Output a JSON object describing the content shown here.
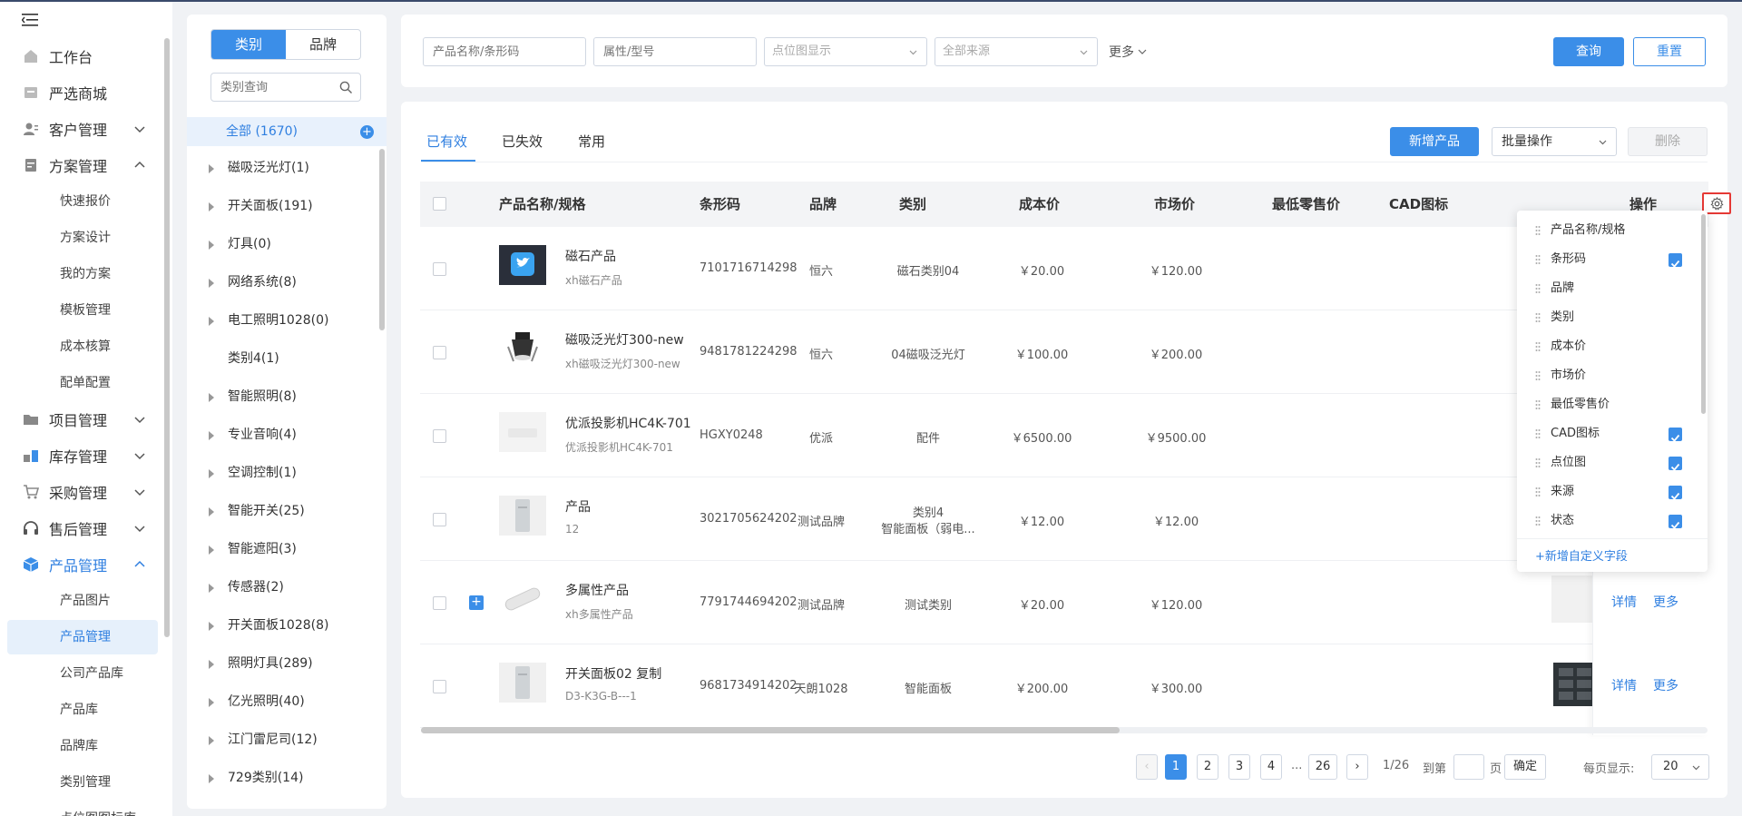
{
  "nav": {
    "top_items": [
      {
        "label": "工作台",
        "icon": "home-icon"
      },
      {
        "label": "严选商城",
        "icon": "shop-icon"
      },
      {
        "label": "客户管理",
        "icon": "user-icon"
      },
      {
        "label": "方案管理",
        "icon": "plan-icon"
      }
    ],
    "plan_subs": [
      "快速报价",
      "方案设计",
      "我的方案",
      "模板管理",
      "成本核算",
      "配单配置"
    ],
    "mid_items": [
      {
        "label": "项目管理",
        "icon": "folder-icon"
      },
      {
        "label": "库存管理",
        "icon": "stock-icon"
      },
      {
        "label": "采购管理",
        "icon": "cart-icon"
      },
      {
        "label": "售后管理",
        "icon": "headset-icon"
      },
      {
        "label": "产品管理",
        "icon": "box-icon"
      }
    ],
    "product_subs": [
      "产品图片",
      "产品管理",
      "公司产品库",
      "产品库",
      "品牌库",
      "类别管理",
      "点位图图标库"
    ]
  },
  "category_panel": {
    "tabs": [
      "类别",
      "品牌"
    ],
    "search_placeholder": "类别查询",
    "all_label": "全部 (1670)",
    "items": [
      "磁吸泛光灯(1)",
      "开关面板(191)",
      "灯具(0)",
      "网络系统(8)",
      "电工照明1028(0)",
      "类别4(1)",
      "智能照明(8)",
      "专业音响(4)",
      "空调控制(1)",
      "智能开关(25)",
      "智能遮阳(3)",
      "传感器(2)",
      "开关面板1028(8)",
      "照明灯具(289)",
      "亿光照明(40)",
      "江门雷尼司(12)",
      "729类别(14)"
    ]
  },
  "filter": {
    "name_placeholder": "产品名称/条形码",
    "attr_placeholder": "属性/型号",
    "point_select": "点位图显示",
    "source_select": "全部来源",
    "more_label": "更多",
    "query_label": "查询",
    "reset_label": "重置"
  },
  "main": {
    "tabs": [
      "已有效",
      "已失效",
      "常用"
    ],
    "add_button": "新增产品",
    "batch_select": "批量操作",
    "delete_button": "删除",
    "columns": [
      "产品名称/规格",
      "条形码",
      "品牌",
      "类别",
      "成本价",
      "市场价",
      "最低零售价",
      "CAD图标",
      "操作"
    ],
    "rows": [
      {
        "name": "磁石产品",
        "sub": "xh磁石产品",
        "barcode": "7101716714298",
        "brand": "恒六",
        "category": "磁石类别04",
        "category2": "",
        "cost": "￥20.00",
        "market": "￥120.00"
      },
      {
        "name": "磁吸泛光灯300-new",
        "sub": "xh磁吸泛光灯300-new",
        "barcode": "9481781224298",
        "brand": "恒六",
        "category": "04磁吸泛光灯",
        "category2": "",
        "cost": "￥100.00",
        "market": "￥200.00"
      },
      {
        "name": "优派投影机HC4K-701",
        "sub": "优派投影机HC4K-701",
        "barcode": "HGXY0248",
        "brand": "优派",
        "category": "配件",
        "category2": "",
        "cost": "￥6500.00",
        "market": "￥9500.00"
      },
      {
        "name": "产品",
        "sub": "12",
        "barcode": "3021705624202",
        "brand": "测试品牌",
        "category": "类别4",
        "category2": "智能面板（弱电...",
        "cost": "￥12.00",
        "market": "￥12.00"
      },
      {
        "name": "多属性产品",
        "sub": "xh多属性产品",
        "barcode": "7791744694202",
        "brand": "测试品牌",
        "category": "测试类别",
        "category2": "",
        "cost": "￥20.00",
        "market": "￥120.00"
      },
      {
        "name": "开关面板02 复制",
        "sub": "D3-K3G-B---1",
        "barcode": "9681734914202",
        "brand": "天朗1028",
        "category": "智能面板",
        "category2": "",
        "cost": "￥200.00",
        "market": "￥300.00"
      }
    ],
    "op_detail": "详情",
    "op_more": "更多",
    "pagination": {
      "pages": [
        "1",
        "2",
        "3",
        "4",
        "...",
        "26"
      ],
      "current": "1",
      "total_text": "1/26",
      "goto_label": "到第",
      "page_unit": "页",
      "confirm": "确定",
      "per_page_label": "每页显示:",
      "per_page_value": "20"
    }
  },
  "column_settings": {
    "items": [
      {
        "label": "产品名称/规格",
        "checked": false
      },
      {
        "label": "条形码",
        "checked": true
      },
      {
        "label": "品牌",
        "checked": false
      },
      {
        "label": "类别",
        "checked": false
      },
      {
        "label": "成本价",
        "checked": false
      },
      {
        "label": "市场价",
        "checked": false
      },
      {
        "label": "最低零售价",
        "checked": false
      },
      {
        "label": "CAD图标",
        "checked": true
      },
      {
        "label": "点位图",
        "checked": true
      },
      {
        "label": "来源",
        "checked": true
      },
      {
        "label": "状态",
        "checked": true
      }
    ],
    "add_label": "+新增自定义字段"
  },
  "colors": {
    "accent": "#3b8ee8",
    "highlight": "#e53935"
  }
}
